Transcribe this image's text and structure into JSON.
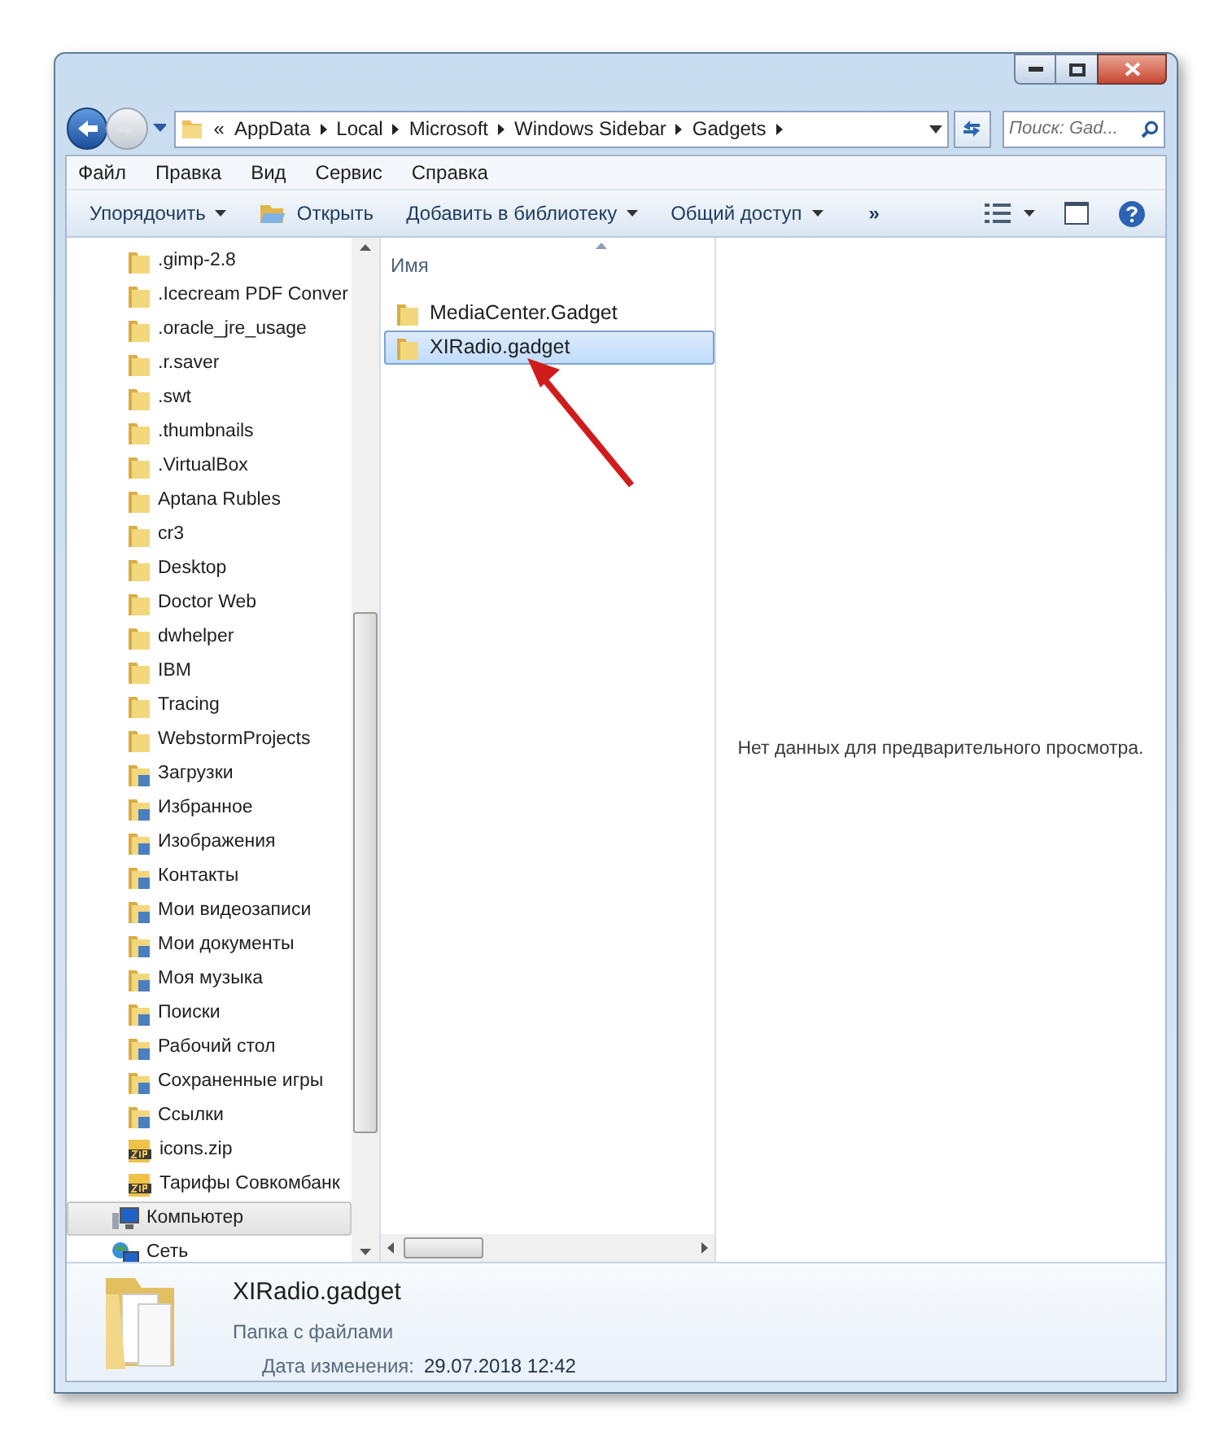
{
  "address_bar": {
    "overflow": "«",
    "segments": [
      "AppData",
      "Local",
      "Microsoft",
      "Windows Sidebar",
      "Gadgets"
    ]
  },
  "search": {
    "placeholder": "Поиск: Gad..."
  },
  "menu": [
    "Файл",
    "Правка",
    "Вид",
    "Сервис",
    "Справка"
  ],
  "toolbar": [
    {
      "label": "Упорядочить",
      "kind": "dropdown"
    },
    {
      "label": "Открыть",
      "kind": "open"
    },
    {
      "label": "Добавить в библиотеку",
      "kind": "dropdown"
    },
    {
      "label": "Общий доступ",
      "kind": "dropdown"
    },
    {
      "label": "»",
      "kind": "more"
    }
  ],
  "sidebar": {
    "items": [
      {
        "label": ".gimp-2.8",
        "kind": "folder",
        "selected": false
      },
      {
        "label": ".Icecream PDF Conver",
        "kind": "folder",
        "selected": false
      },
      {
        "label": ".oracle_jre_usage",
        "kind": "folder",
        "selected": false
      },
      {
        "label": ".r.saver",
        "kind": "folder",
        "selected": false
      },
      {
        "label": ".swt",
        "kind": "folder",
        "selected": false
      },
      {
        "label": ".thumbnails",
        "kind": "folder",
        "selected": false
      },
      {
        "label": ".VirtualBox",
        "kind": "folder",
        "selected": false
      },
      {
        "label": "Aptana Rubles",
        "kind": "folder",
        "selected": false
      },
      {
        "label": "cr3",
        "kind": "folder",
        "selected": false
      },
      {
        "label": "Desktop",
        "kind": "folder",
        "selected": false
      },
      {
        "label": "Doctor Web",
        "kind": "folder",
        "selected": false
      },
      {
        "label": "dwhelper",
        "kind": "folder",
        "selected": false
      },
      {
        "label": "IBM",
        "kind": "folder",
        "selected": false
      },
      {
        "label": "Tracing",
        "kind": "folder",
        "selected": false
      },
      {
        "label": "WebstormProjects",
        "kind": "folder",
        "selected": false
      },
      {
        "label": "Загрузки",
        "kind": "special",
        "selected": false
      },
      {
        "label": "Избранное",
        "kind": "special",
        "selected": false
      },
      {
        "label": "Изображения",
        "kind": "special",
        "selected": false
      },
      {
        "label": "Контакты",
        "kind": "special",
        "selected": false
      },
      {
        "label": "Мои видеозаписи",
        "kind": "special",
        "selected": false
      },
      {
        "label": "Мои документы",
        "kind": "special",
        "selected": false
      },
      {
        "label": "Моя музыка",
        "kind": "special",
        "selected": false
      },
      {
        "label": "Поиски",
        "kind": "special",
        "selected": false
      },
      {
        "label": "Рабочий стол",
        "kind": "special",
        "selected": false
      },
      {
        "label": "Сохраненные игры",
        "kind": "special",
        "selected": false
      },
      {
        "label": "Ссылки",
        "kind": "special",
        "selected": false
      },
      {
        "label": "icons.zip",
        "kind": "zip",
        "selected": false
      },
      {
        "label": "Тарифы Совкомбанк",
        "kind": "zip",
        "selected": false
      },
      {
        "label": "Компьютер",
        "kind": "computer",
        "selected": true
      },
      {
        "label": "Сеть",
        "kind": "network",
        "selected": false
      }
    ]
  },
  "file_list": {
    "column": "Имя",
    "items": [
      {
        "label": "MediaCenter.Gadget",
        "selected": false
      },
      {
        "label": "XIRadio.gadget",
        "selected": true
      }
    ]
  },
  "preview": {
    "message": "Нет данных для предварительного просмотра."
  },
  "details": {
    "name": "XIRadio.gadget",
    "type": "Папка с файлами",
    "date_label": "Дата изменения:",
    "date_value": "29.07.2018 12:42"
  }
}
